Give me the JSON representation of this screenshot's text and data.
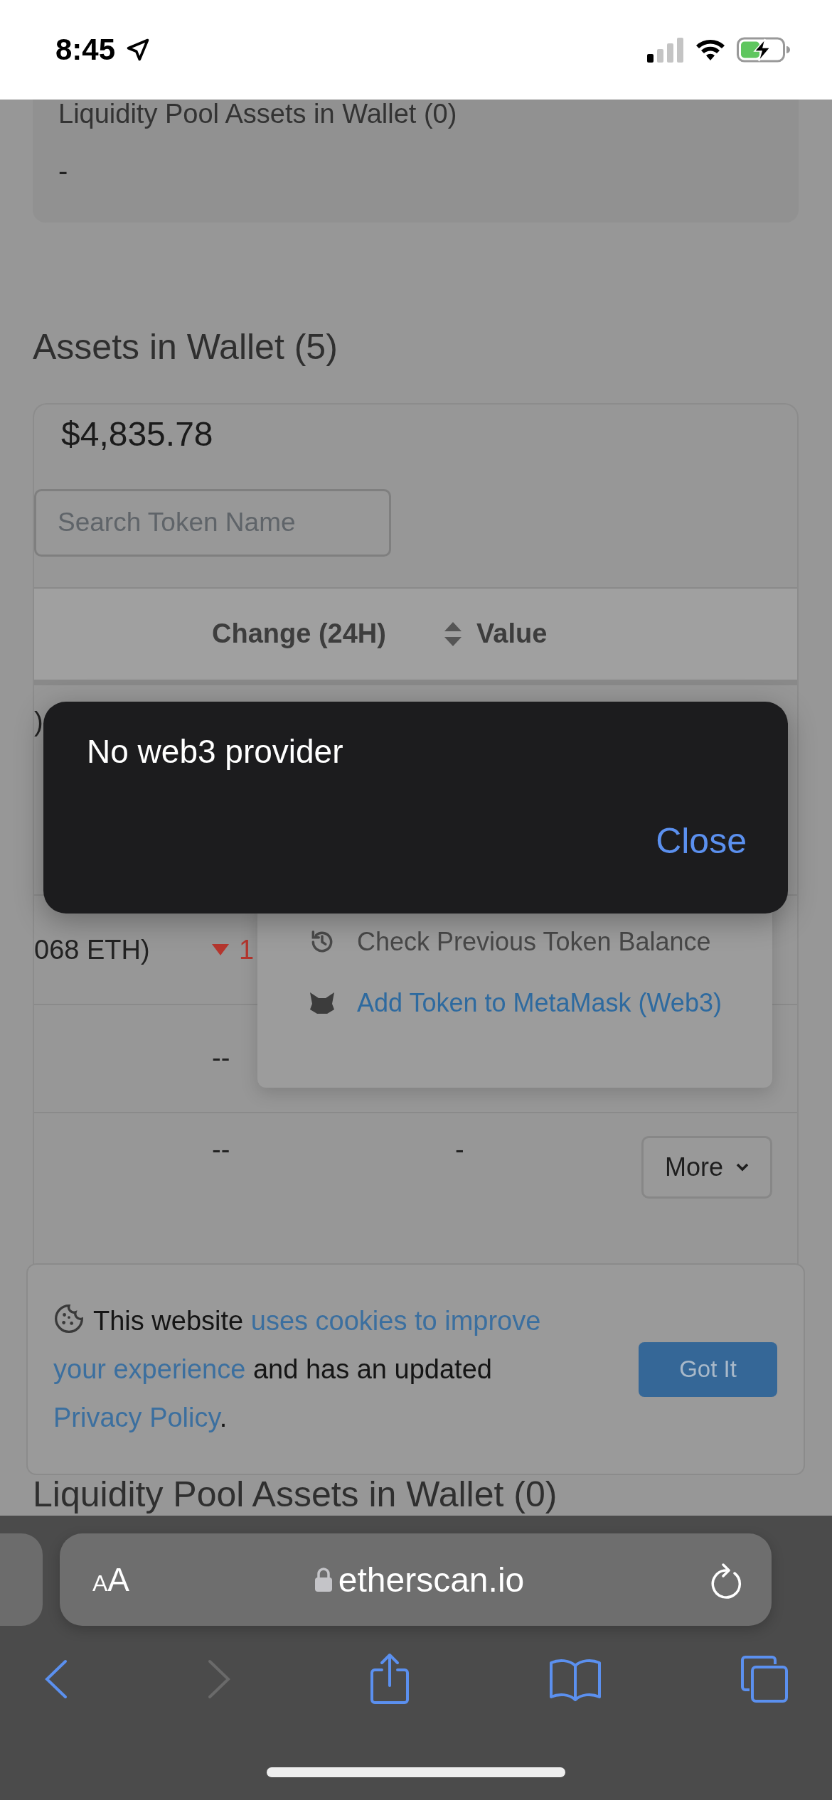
{
  "status_bar": {
    "time": "8:45"
  },
  "liquidity_top": {
    "title": "Liquidity Pool Assets in Wallet (0)",
    "value": "-"
  },
  "assets": {
    "heading": "Assets in Wallet (5)",
    "total": "$4,835.78",
    "search": {
      "placeholder": "Search Token Name"
    },
    "columns": [
      "Change (24H)",
      "Value"
    ],
    "rows": [
      {
        "column_1": ")"
      },
      {
        "column_1": "068 ETH)",
        "change": "1",
        "falling": true
      },
      {
        "change": "--"
      },
      {
        "change": "--",
        "value": "-",
        "action": "More"
      }
    ]
  },
  "dropdown": {
    "items": [
      {
        "kind": "history",
        "label": "Check Previous Token Balance"
      },
      {
        "kind": "metamask",
        "label": "Add Token to MetaMask (Web3)"
      }
    ]
  },
  "dialog": {
    "message": "No web3 provider",
    "button": "Close"
  },
  "cookie_banner": {
    "parts": [
      {
        "text": "This website ",
        "link": false
      },
      {
        "text": "uses cookies to improve",
        "link": true
      },
      {
        "text": "your experience",
        "link": true
      },
      {
        "text": " and has an updated ",
        "link": false
      },
      {
        "text": "Privacy Policy",
        "link": true
      },
      {
        "text": ".",
        "link": false
      }
    ],
    "button": "Got It"
  },
  "liquidity_bottom": {
    "title": "Liquidity Pool Assets in Wallet (0)"
  },
  "browser": {
    "text_size": "AA",
    "address": "etherscan.io",
    "back": {
      "disabled": false
    },
    "forward": {
      "disabled": true
    }
  }
}
